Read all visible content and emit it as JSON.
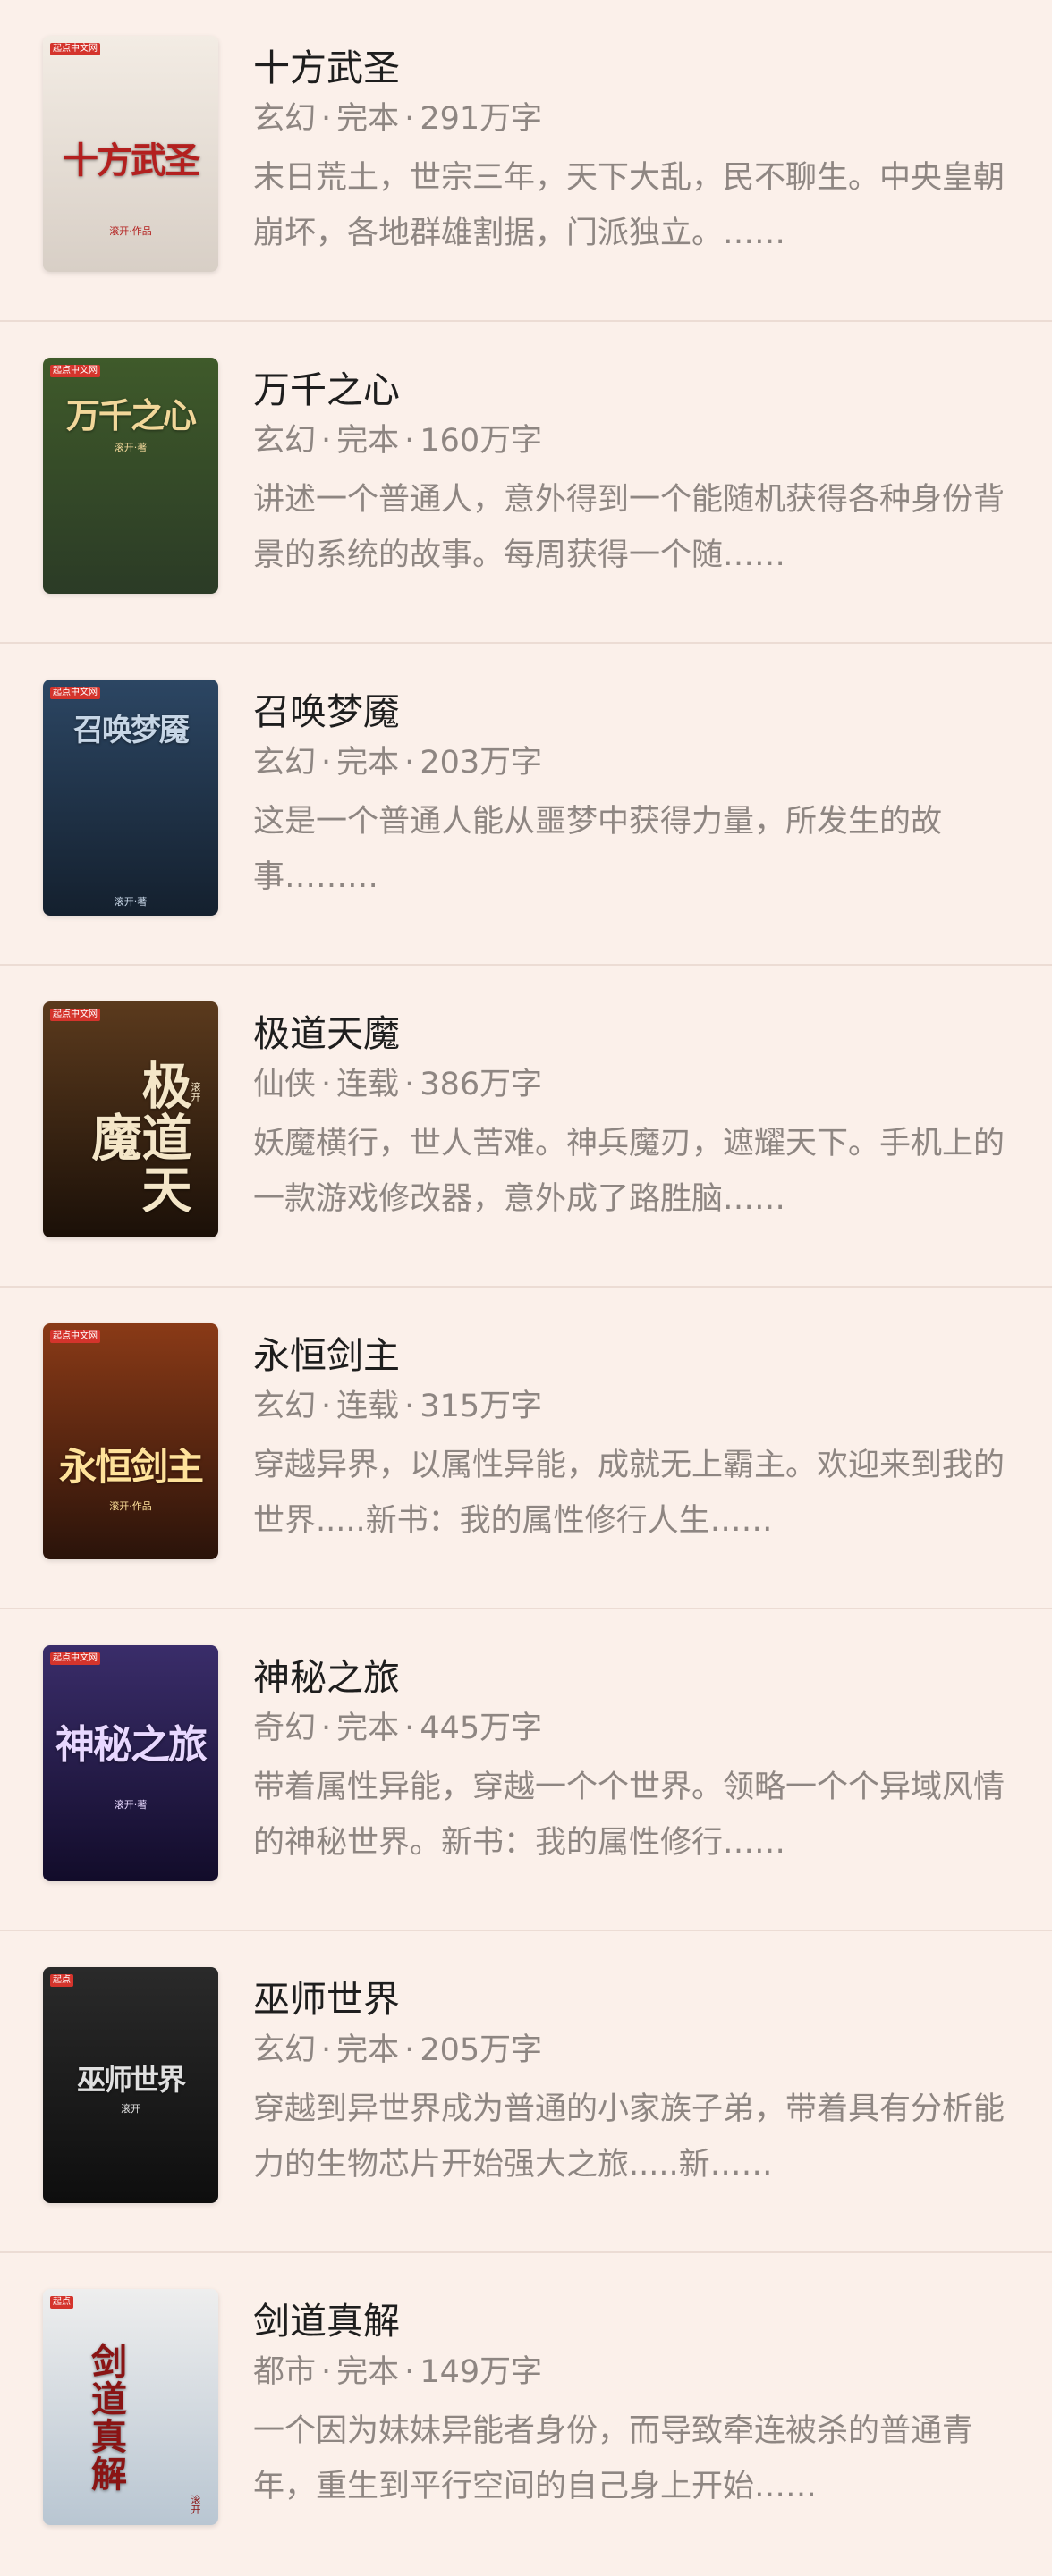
{
  "books": [
    {
      "title": "十方武圣",
      "genre": "玄幻",
      "status": "完本",
      "words": "291万字",
      "desc": "末日荒土，世宗三年，天下大乱，民不聊生。中央皇朝崩坏，各地群雄割据，门派独立。……",
      "cover": {
        "title": "十方武圣",
        "author": "滚开·作品",
        "badge": "起点中文网",
        "bg_top": "#f3ece4",
        "bg_bottom": "#d8cfc6",
        "title_color": "#b3201f"
      }
    },
    {
      "title": "万千之心",
      "genre": "玄幻",
      "status": "完本",
      "words": "160万字",
      "desc": "讲述一个普通人，意外得到一个能随机获得各种身份背景的系统的故事。每周获得一个随……",
      "cover": {
        "title": "万千之心",
        "author": "滚开·著",
        "badge": "起点中文网",
        "bg_top": "#3f5a2a",
        "bg_bottom": "#2b3b26",
        "title_color": "#f2d79a"
      }
    },
    {
      "title": "召唤梦魇",
      "genre": "玄幻",
      "status": "完本",
      "words": "203万字",
      "desc": "这是一个普通人能从噩梦中获得力量，所发生的故事………",
      "cover": {
        "title": "召唤梦魇",
        "author": "滚开·著",
        "badge": "起点中文网",
        "bg_top": "#2c4663",
        "bg_bottom": "#14202e",
        "title_color": "#c7d6e6"
      }
    },
    {
      "title": "极道天魔",
      "genre": "仙侠",
      "status": "连载",
      "words": "386万字",
      "desc": "妖魔横行，世人苦难。神兵魔刃，遮耀天下。手机上的一款游戏修改器，意外成了路胜脑……",
      "cover": {
        "title": "极道天魔",
        "author": "滚开",
        "badge": "起点中文网",
        "bg_top": "#5b3a1d",
        "bg_bottom": "#1b1008",
        "title_color": "#f4e6c8"
      }
    },
    {
      "title": "永恒剑主",
      "genre": "玄幻",
      "status": "连载",
      "words": "315万字",
      "desc": "穿越异界，以属性异能，成就无上霸主。欢迎来到我的世界.....新书：我的属性修行人生……",
      "cover": {
        "title": "永恒剑主",
        "author": "滚开·作品",
        "badge": "起点中文网",
        "bg_top": "#8a3a17",
        "bg_bottom": "#2a130a",
        "title_color": "#ffe29a"
      }
    },
    {
      "title": "神秘之旅",
      "genre": "奇幻",
      "status": "完本",
      "words": "445万字",
      "desc": "带着属性异能，穿越一个个世界。领略一个个异域风情的神秘世界。新书：我的属性修行……",
      "cover": {
        "title": "神秘之旅",
        "author": "滚开·著",
        "badge": "起点中文网",
        "bg_top": "#3a2d6a",
        "bg_bottom": "#120c2a",
        "title_color": "#e8d8ff"
      }
    },
    {
      "title": "巫师世界",
      "genre": "玄幻",
      "status": "完本",
      "words": "205万字",
      "desc": "穿越到异世界成为普通的小家族子弟，带着具有分析能力的生物芯片开始强大之旅.....新……",
      "cover": {
        "title": "巫师世界",
        "author": "滚开",
        "badge": "起点",
        "bg_top": "#2a2a2a",
        "bg_bottom": "#0e0e0e",
        "title_color": "#e0e0e0"
      }
    },
    {
      "title": "剑道真解",
      "genre": "都市",
      "status": "完本",
      "words": "149万字",
      "desc": "一个因为妹妹异能者身份，而导致牵连被杀的普通青年，重生到平行空间的自己身上开始……",
      "cover": {
        "title": "剑道真解",
        "author": "滚开",
        "badge": "起点",
        "bg_top": "#eeeeee",
        "bg_bottom": "#b9c6d2",
        "title_color": "#8a1414"
      }
    }
  ],
  "meta_separator": "·"
}
